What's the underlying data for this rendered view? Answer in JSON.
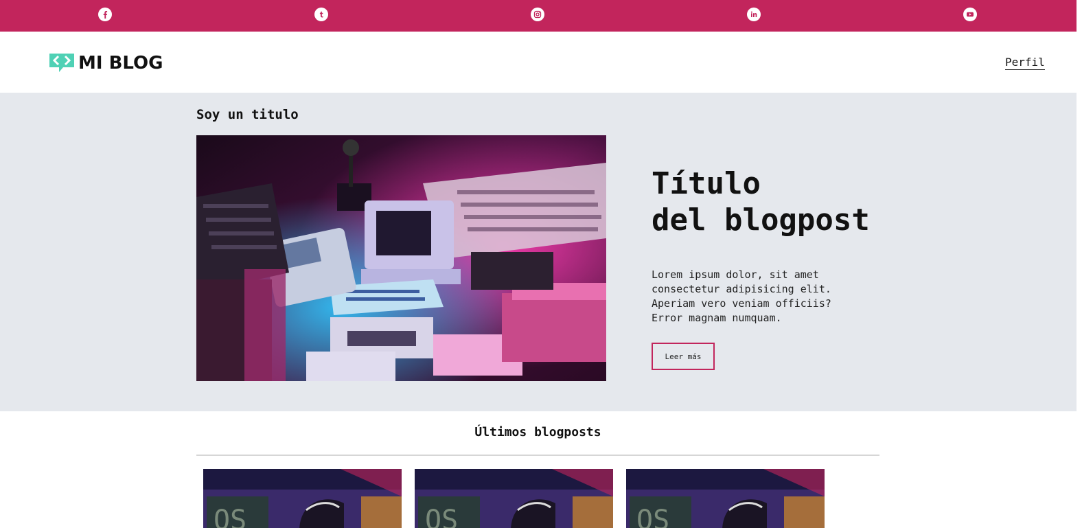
{
  "social": {
    "icons": [
      "facebook-icon",
      "tumblr-icon",
      "instagram-icon",
      "linkedin-icon",
      "youtube-icon"
    ],
    "bar_color": "#c2255c"
  },
  "header": {
    "logo_text": "MI BLOG",
    "logo_icon": "code-chat-icon",
    "logo_color": "#4fd1b5",
    "nav_profile": "Perfil"
  },
  "hero": {
    "section_title": "Soy un titulo",
    "image_subject": "retro-computers-photo",
    "post_title_line1": "Título",
    "post_title_line2": "del blogpost",
    "excerpt": "Lorem ipsum dolor, sit amet consectetur adipisicing elit. Aperiam vero veniam officiis? Error magnam numquam.",
    "button_label": "Leer más",
    "background": "#e5e8ed",
    "accent": "#c2255c"
  },
  "latest": {
    "heading": "Últimos blogposts",
    "cards": [
      {
        "image_subject": "vr-headset-photo"
      },
      {
        "image_subject": "vr-headset-photo"
      },
      {
        "image_subject": "vr-headset-photo"
      }
    ]
  }
}
